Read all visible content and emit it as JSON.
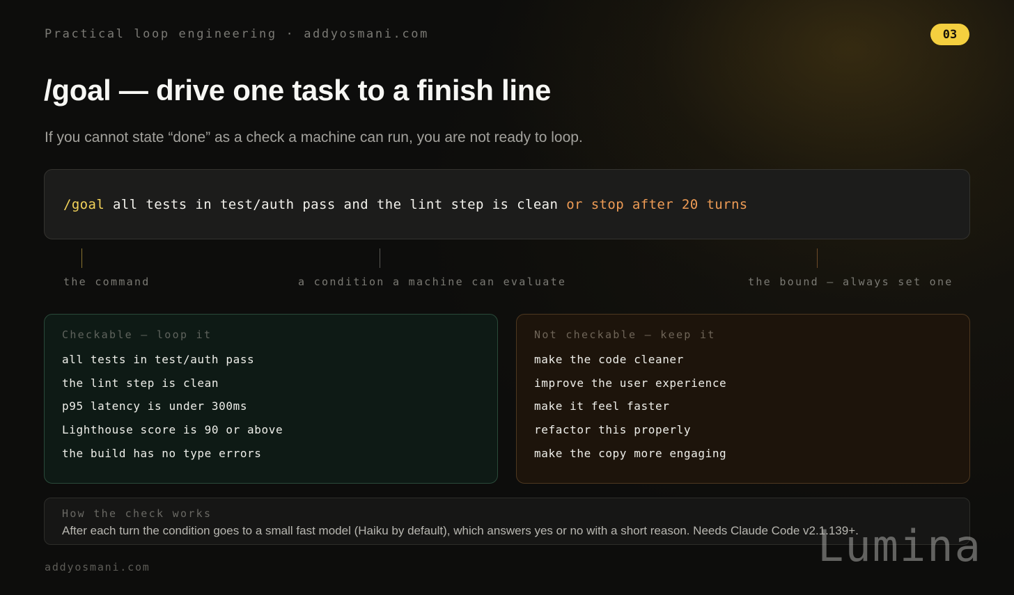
{
  "header": {
    "kicker": "Practical loop engineering · addyosmani.com",
    "slide_number": "03"
  },
  "title": "/goal — drive one task to a finish line",
  "subtitle": "If you cannot state “done” as a check a machine can run, you are not ready to loop.",
  "command": {
    "slash": "/goal",
    "condition": " all tests in test/auth pass and the lint step is clean ",
    "bound": "or stop after 20 turns"
  },
  "annotations": {
    "command": "the command",
    "condition": "a condition a machine can evaluate",
    "bound": "the bound — always set one"
  },
  "checkable": {
    "heading": "Checkable — loop it",
    "items": [
      "all tests in test/auth pass",
      "the lint step is clean",
      "p95 latency is under 300ms",
      "Lighthouse score is 90 or above",
      "the build has no type errors"
    ]
  },
  "not_checkable": {
    "heading": "Not checkable — keep it",
    "items": [
      "make the code cleaner",
      "improve the user experience",
      "make it feel faster",
      "refactor this properly",
      "make the copy more engaging"
    ]
  },
  "how_check_works": {
    "heading": "How the check works",
    "body": "After each turn the condition goes to a small fast model (Haiku by default), which answers yes or no with a short reason. Needs Claude Code v2.1.139+."
  },
  "footer": "addyosmani.com",
  "watermark": "Lumina",
  "colors": {
    "accent_yellow": "#f4cf3f",
    "command_yellow": "#f3d35a",
    "bound_orange": "#ef9c55",
    "green_border": "#2a4a3a",
    "amber_border": "#4e3820"
  }
}
